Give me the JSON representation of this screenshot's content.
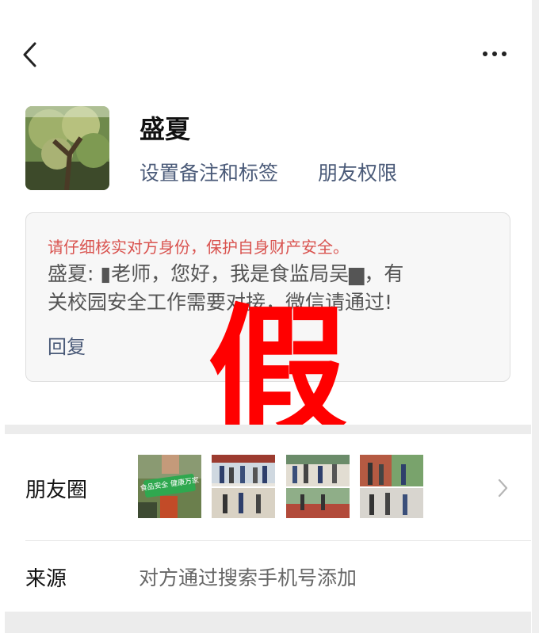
{
  "header": {
    "back_icon": "chevron-left-icon",
    "more_icon": "more-horizontal-icon"
  },
  "profile": {
    "name": "盛夏",
    "remark_link": "设置备注和标签",
    "permission_link": "朋友权限",
    "avatar_icon": "avatar-tree-photo"
  },
  "request": {
    "warning": "请仔细核实对方身份，保护自身财产安全。",
    "message_line1": "盛夏: ▮老师，您好，我是食监局吴▆，有",
    "message_line2": "关校园安全工作需要对接，微信请通过!",
    "reply": "回复"
  },
  "overlay": {
    "stamp": "假",
    "stamp_color": "#ff0000"
  },
  "moments": {
    "label": "朋友圈",
    "thumbnail_banner_text": "食品安全 健康万家",
    "chevron_icon": "chevron-right-icon"
  },
  "source": {
    "label": "来源",
    "value": "对方通过搜索手机号添加"
  },
  "colors": {
    "link": "#4a5a78",
    "warning": "#d9534f",
    "separator": "#ececec"
  }
}
